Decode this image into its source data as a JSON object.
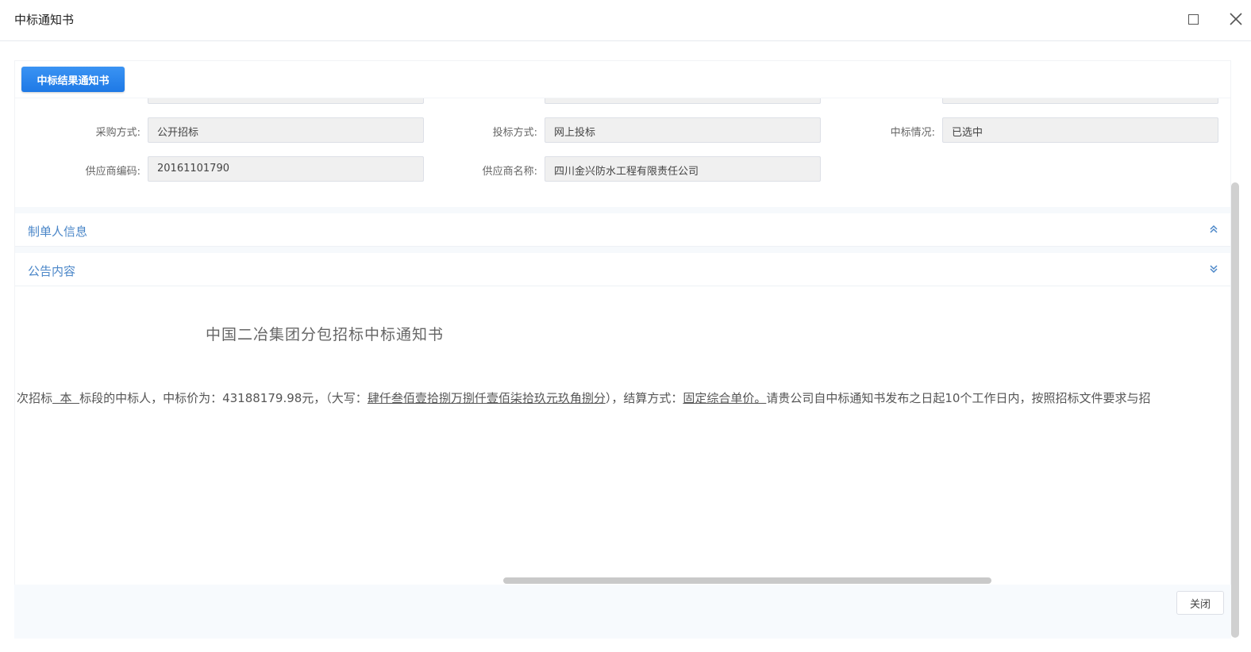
{
  "window": {
    "title": "中标通知书"
  },
  "tab": {
    "label": "中标结果通知书"
  },
  "fields": {
    "purchase_method": {
      "label": "采购方式:",
      "value": "公开招标"
    },
    "bid_method": {
      "label": "投标方式:",
      "value": "网上投标"
    },
    "award_status": {
      "label": "中标情况:",
      "value": "已选中"
    },
    "supplier_code": {
      "label": "供应商编码:",
      "value": "20161101790"
    },
    "supplier_name": {
      "label": "供应商名称:",
      "value": "四川金兴防水工程有限责任公司"
    }
  },
  "sections": {
    "creator_info": {
      "title": "制单人信息"
    },
    "announcement": {
      "title": "公告内容"
    }
  },
  "notice": {
    "title": "中国二冶集团分包招标中标通知书",
    "body_part1": "次招标",
    "body_scope": "  本  ",
    "body_part2": "标段的中标人，中标价为：43188179.98元，（大写：",
    "body_amount_words": "肆仟叁佰壹拾捌万捌仟壹佰柒拾玖元玖角捌分",
    "body_part3": "），结算方式：",
    "body_settlement": "固定综合单价。",
    "body_part4": "请贵公司自中标通知书发布之日起10个工作日内，按照招标文件要求与招"
  },
  "footer": {
    "close_label": "关闭"
  }
}
